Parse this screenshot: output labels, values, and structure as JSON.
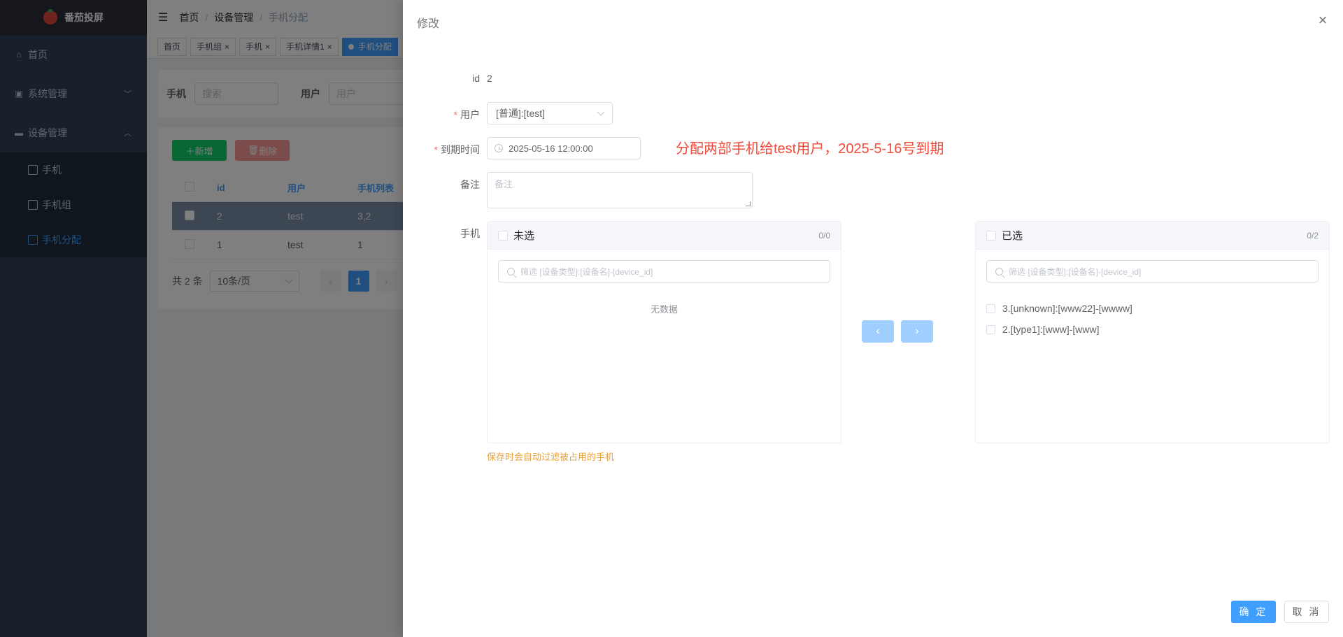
{
  "app": {
    "logo_text": "番茄投屏"
  },
  "sidebar": {
    "items": [
      {
        "label": "首页"
      },
      {
        "label": "系统管理"
      },
      {
        "label": "设备管理"
      }
    ],
    "sub_items": [
      {
        "label": "手机"
      },
      {
        "label": "手机组"
      },
      {
        "label": "手机分配"
      }
    ]
  },
  "breadcrumb": [
    "首页",
    "设备管理",
    "手机分配"
  ],
  "tags": [
    "首页",
    "手机组",
    "手机",
    "手机详情1",
    "手机分配"
  ],
  "search": {
    "phone_label": "手机",
    "phone_placeholder": "搜索",
    "user_label": "用户",
    "user_placeholder": "用户"
  },
  "toolbar": {
    "add_label": "新增",
    "delete_label": "删除"
  },
  "table": {
    "headers": [
      "id",
      "用户",
      "手机列表"
    ],
    "rows": [
      {
        "id": "2",
        "user": "test",
        "phones": "3,2"
      },
      {
        "id": "1",
        "user": "test",
        "phones": "1"
      }
    ]
  },
  "pagination": {
    "total": "共 2 条",
    "size": "10条/页",
    "current": "1"
  },
  "drawer": {
    "title": "修改",
    "id_label": "id",
    "id_value": "2",
    "user_label": "用户",
    "user_value": "[普通]:[test]",
    "expire_label": "到期时间",
    "expire_value": "2025-05-16 12:00:00",
    "annotation": "分配两部手机给test用户，2025-5-16号到期",
    "remark_label": "备注",
    "remark_placeholder": "备注",
    "phone_label": "手机",
    "left_panel": {
      "title": "未选",
      "count": "0/0",
      "filter_placeholder": "筛选  [设备类型]:[设备名]-[device_id]",
      "empty_text": "无数据"
    },
    "right_panel": {
      "title": "已选",
      "count": "0/2",
      "filter_placeholder": "筛选  [设备类型]:[设备名]-[device_id]",
      "items": [
        "3.[unknown]:[www22]-[wwww]",
        "2.[type1]:[www]-[www]"
      ]
    },
    "hint": "保存时会自动过滤被占用的手机",
    "confirm_label": "确 定",
    "cancel_label": "取 消"
  }
}
